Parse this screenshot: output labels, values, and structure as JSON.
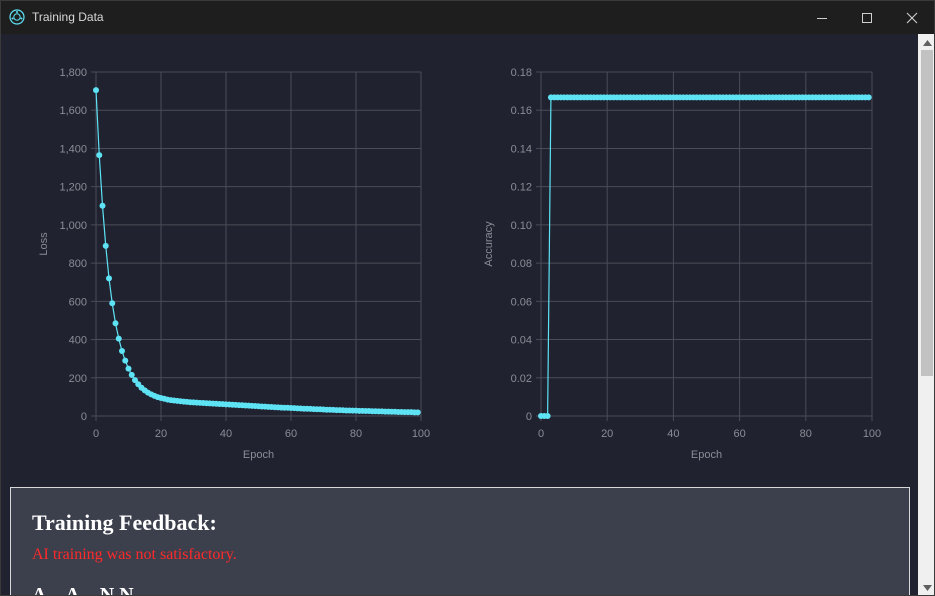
{
  "window": {
    "title": "Training Data",
    "icon": "app-logo-icon",
    "controls": [
      "minimize-icon",
      "maximize-icon",
      "close-icon"
    ]
  },
  "chart_data": [
    {
      "type": "line",
      "xlabel": "Epoch",
      "ylabel": "Loss",
      "xlim": [
        0,
        100
      ],
      "ylim": [
        0,
        1800
      ],
      "xticks": [
        0,
        20,
        40,
        60,
        80,
        100
      ],
      "yticks": [
        0,
        200,
        400,
        600,
        800,
        1000,
        1200,
        1400,
        1600,
        1800
      ],
      "ytick_labels": [
        "0",
        "200",
        "400",
        "600",
        "800",
        "1,000",
        "1,200",
        "1,400",
        "1,600",
        "1,800"
      ],
      "xtick_labels": [
        "0",
        "20",
        "40",
        "60",
        "80",
        "100"
      ],
      "grid": true,
      "color": "#5ee3f5",
      "series": [
        {
          "x": [
            0,
            1,
            2,
            3,
            4,
            5,
            6,
            7,
            8,
            9,
            10,
            11,
            12,
            13,
            14,
            15,
            16,
            17,
            18,
            19,
            20,
            21,
            22,
            23,
            24,
            25,
            26,
            27,
            28,
            29,
            30,
            31,
            32,
            33,
            34,
            35,
            36,
            37,
            38,
            39,
            40,
            41,
            42,
            43,
            44,
            45,
            46,
            47,
            48,
            49,
            50,
            51,
            52,
            53,
            54,
            55,
            56,
            57,
            58,
            59,
            60,
            61,
            62,
            63,
            64,
            65,
            66,
            67,
            68,
            69,
            70,
            71,
            72,
            73,
            74,
            75,
            76,
            77,
            78,
            79,
            80,
            81,
            82,
            83,
            84,
            85,
            86,
            87,
            88,
            89,
            90,
            91,
            92,
            93,
            94,
            95,
            96,
            97,
            98,
            99
          ],
          "y": [
            1705,
            1365,
            1100,
            890,
            720,
            590,
            485,
            405,
            340,
            290,
            248,
            215,
            188,
            166,
            148,
            134,
            122,
            113,
            105,
            99,
            94,
            90,
            86,
            83,
            81,
            79,
            77,
            75,
            74,
            72,
            71,
            70,
            69,
            68,
            67,
            66,
            65,
            64,
            63,
            62,
            61,
            60,
            59,
            58,
            57,
            56,
            55,
            54,
            53,
            52,
            51,
            50,
            49,
            48,
            47,
            46,
            45,
            44,
            43,
            43,
            42,
            41,
            40,
            39,
            38,
            38,
            37,
            36,
            35,
            35,
            34,
            33,
            33,
            32,
            31,
            31,
            30,
            29,
            29,
            28,
            28,
            27,
            27,
            26,
            26,
            25,
            25,
            24,
            24,
            23,
            23,
            22,
            22,
            21,
            21,
            20,
            20,
            20,
            19,
            19
          ]
        }
      ]
    },
    {
      "type": "line",
      "xlabel": "Epoch",
      "ylabel": "Accuracy",
      "xlim": [
        0,
        100
      ],
      "ylim": [
        0,
        0.18
      ],
      "xticks": [
        0,
        20,
        40,
        60,
        80,
        100
      ],
      "yticks": [
        0,
        0.02,
        0.04,
        0.06,
        0.08,
        0.1,
        0.12,
        0.14,
        0.16,
        0.18
      ],
      "ytick_labels": [
        "0",
        "0.02",
        "0.04",
        "0.06",
        "0.08",
        "0.10",
        "0.12",
        "0.14",
        "0.16",
        "0.18"
      ],
      "xtick_labels": [
        "0",
        "20",
        "40",
        "60",
        "80",
        "100"
      ],
      "grid": true,
      "color": "#5ee3f5",
      "series": [
        {
          "x": [
            0,
            1,
            2,
            3,
            4,
            5,
            6,
            7,
            8,
            9,
            10,
            11,
            12,
            13,
            14,
            15,
            16,
            17,
            18,
            19,
            20,
            21,
            22,
            23,
            24,
            25,
            26,
            27,
            28,
            29,
            30,
            31,
            32,
            33,
            34,
            35,
            36,
            37,
            38,
            39,
            40,
            41,
            42,
            43,
            44,
            45,
            46,
            47,
            48,
            49,
            50,
            51,
            52,
            53,
            54,
            55,
            56,
            57,
            58,
            59,
            60,
            61,
            62,
            63,
            64,
            65,
            66,
            67,
            68,
            69,
            70,
            71,
            72,
            73,
            74,
            75,
            76,
            77,
            78,
            79,
            80,
            81,
            82,
            83,
            84,
            85,
            86,
            87,
            88,
            89,
            90,
            91,
            92,
            93,
            94,
            95,
            96,
            97,
            98,
            99
          ],
          "y": [
            0,
            0,
            0,
            0.1667,
            0.1667,
            0.1667,
            0.1667,
            0.1667,
            0.1667,
            0.1667,
            0.1667,
            0.1667,
            0.1667,
            0.1667,
            0.1667,
            0.1667,
            0.1667,
            0.1667,
            0.1667,
            0.1667,
            0.1667,
            0.1667,
            0.1667,
            0.1667,
            0.1667,
            0.1667,
            0.1667,
            0.1667,
            0.1667,
            0.1667,
            0.1667,
            0.1667,
            0.1667,
            0.1667,
            0.1667,
            0.1667,
            0.1667,
            0.1667,
            0.1667,
            0.1667,
            0.1667,
            0.1667,
            0.1667,
            0.1667,
            0.1667,
            0.1667,
            0.1667,
            0.1667,
            0.1667,
            0.1667,
            0.1667,
            0.1667,
            0.1667,
            0.1667,
            0.1667,
            0.1667,
            0.1667,
            0.1667,
            0.1667,
            0.1667,
            0.1667,
            0.1667,
            0.1667,
            0.1667,
            0.1667,
            0.1667,
            0.1667,
            0.1667,
            0.1667,
            0.1667,
            0.1667,
            0.1667,
            0.1667,
            0.1667,
            0.1667,
            0.1667,
            0.1667,
            0.1667,
            0.1667,
            0.1667,
            0.1667,
            0.1667,
            0.1667,
            0.1667,
            0.1667,
            0.1667,
            0.1667,
            0.1667,
            0.1667,
            0.1667,
            0.1667,
            0.1667,
            0.1667,
            0.1667,
            0.1667,
            0.1667,
            0.1667,
            0.1667,
            0.1667,
            0.1667
          ]
        }
      ]
    }
  ],
  "feedback": {
    "title": "Training Feedback:",
    "message": "AI training was not satisfactory.",
    "message_color": "#ff2a2a",
    "truncated_line": "A... A... N N"
  }
}
